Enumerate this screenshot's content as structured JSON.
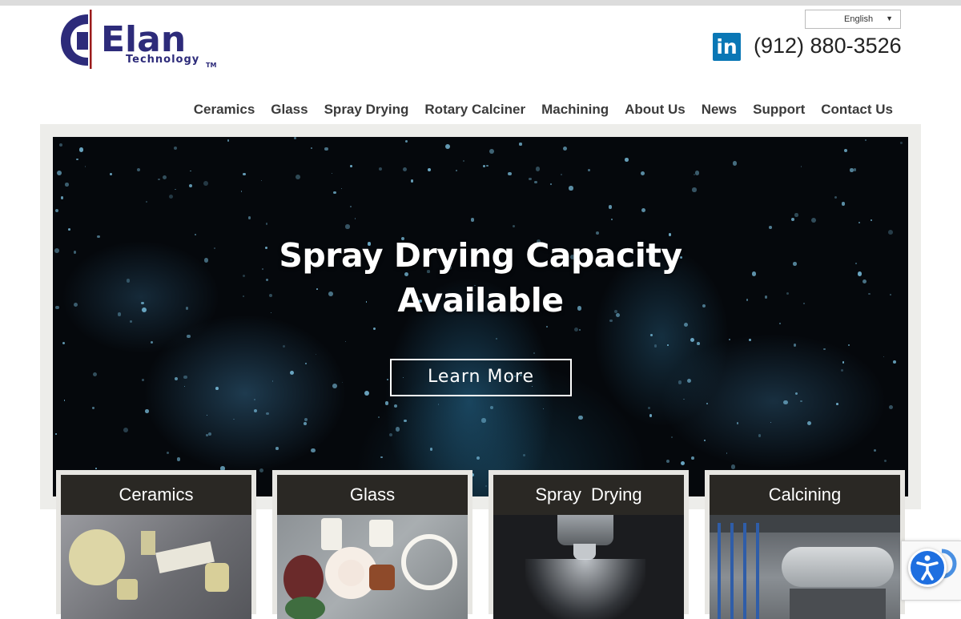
{
  "header": {
    "logo_name": "Elan",
    "logo_sub": "Technology",
    "logo_tm": "TM",
    "language": "English",
    "linkedin_label": "in",
    "phone": "(912) 880-3526"
  },
  "nav": {
    "items": [
      {
        "label": "Ceramics"
      },
      {
        "label": "Glass"
      },
      {
        "label": "Spray Drying"
      },
      {
        "label": "Rotary Calciner"
      },
      {
        "label": "Machining"
      },
      {
        "label": "About Us"
      },
      {
        "label": "News"
      },
      {
        "label": "Support"
      },
      {
        "label": "Contact Us"
      }
    ]
  },
  "hero": {
    "title_line1": "Spray Drying Capacity",
    "title_line2": "Available",
    "button": "Learn More"
  },
  "cards": [
    {
      "title": "Ceramics"
    },
    {
      "title": "Glass"
    },
    {
      "title": "Spray  Drying"
    },
    {
      "title": "Calcining"
    }
  ],
  "colors": {
    "brand": "#2d2b7a",
    "logo_accent": "#9b1b1b",
    "linkedin": "#0a77b5",
    "card_header": "#2a2824",
    "accessibility": "#1e6fe0"
  },
  "icons": {
    "linkedin": "linkedin-icon",
    "dropdown": "chevron-down-icon",
    "accessibility": "accessibility-icon",
    "recaptcha": "recaptcha-icon"
  }
}
